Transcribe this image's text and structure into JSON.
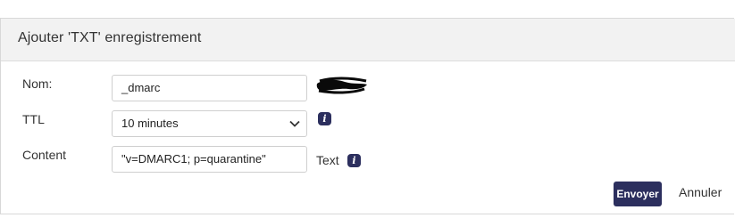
{
  "dialog": {
    "title": "Ajouter 'TXT' enregistrement"
  },
  "form": {
    "name": {
      "label": "Nom:",
      "value": "_dmarc"
    },
    "ttl": {
      "label": "TTL",
      "selected": "10 minutes",
      "info_icon": "i"
    },
    "content": {
      "label": "Content",
      "value": "\"v=DMARC1; p=quarantine\"",
      "type_hint": "Text",
      "info_icon": "i"
    }
  },
  "actions": {
    "submit_label": "Envoyer",
    "cancel_label": "Annuler"
  },
  "colors": {
    "accent": "#2c2f5e",
    "header_bg": "#f2f2f2",
    "border": "#d8d8d8"
  },
  "icons": [
    "info-icon",
    "chevron-down-icon"
  ]
}
